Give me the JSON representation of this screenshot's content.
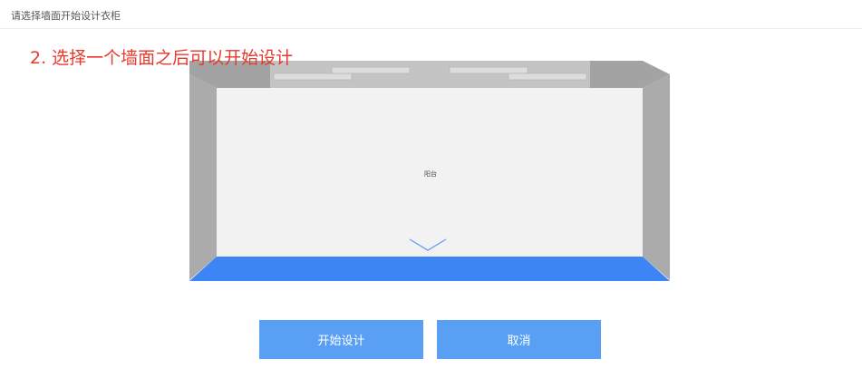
{
  "header": {
    "title": "请选择墙面开始设计衣柜"
  },
  "hint": {
    "text": "2. 选择一个墙面之后可以开始设计"
  },
  "room": {
    "label": "阳台",
    "selected_wall": "bottom",
    "colors": {
      "floor": "#f2f2f2",
      "side_wall": "#ababab",
      "top_wall": "#c4c4c4",
      "corner": "#a3a3a3",
      "selected_wall": "#3d84f5",
      "window": "#dcdcdc",
      "down_arrow": "#5a9cf2"
    }
  },
  "buttons": {
    "start_label": "开始设计",
    "cancel_label": "取消"
  },
  "colors": {
    "button_bg": "#59a0f5",
    "hint": "#e8392b"
  }
}
